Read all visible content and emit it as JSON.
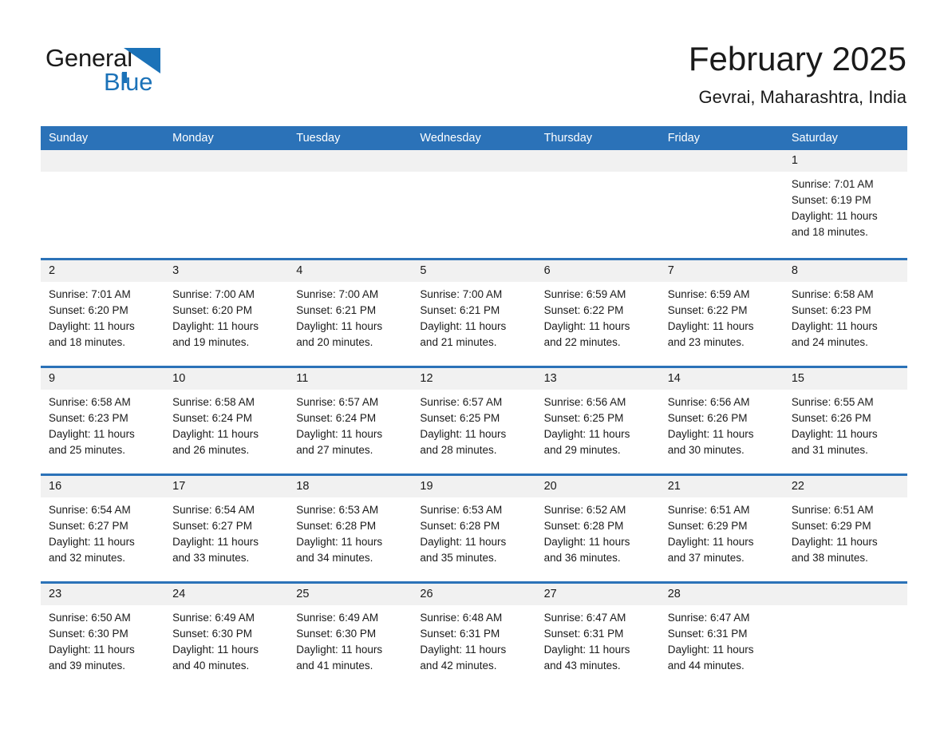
{
  "brand": {
    "name_part1": "General",
    "name_part2": "Blue",
    "accent_color": "#1b72b8"
  },
  "header": {
    "title": "February 2025",
    "subtitle": "Gevrai, Maharashtra, India"
  },
  "theme": {
    "header_bg": "#2b72b8",
    "daynum_band_bg": "#f1f1f1",
    "separator_color": "#2b72b8",
    "text_color": "#1a1a1a",
    "page_bg": "#ffffff"
  },
  "weekday_headers": [
    "Sunday",
    "Monday",
    "Tuesday",
    "Wednesday",
    "Thursday",
    "Friday",
    "Saturday"
  ],
  "labels": {
    "sunrise_prefix": "Sunrise:",
    "sunset_prefix": "Sunset:",
    "daylight_prefix": "Daylight:"
  },
  "weeks": [
    [
      {
        "day": "",
        "empty": true
      },
      {
        "day": "",
        "empty": true
      },
      {
        "day": "",
        "empty": true
      },
      {
        "day": "",
        "empty": true
      },
      {
        "day": "",
        "empty": true
      },
      {
        "day": "",
        "empty": true
      },
      {
        "day": "1",
        "sunrise": "Sunrise: 7:01 AM",
        "sunset": "Sunset: 6:19 PM",
        "daylight_line1": "Daylight: 11 hours",
        "daylight_line2": "and 18 minutes."
      }
    ],
    [
      {
        "day": "2",
        "sunrise": "Sunrise: 7:01 AM",
        "sunset": "Sunset: 6:20 PM",
        "daylight_line1": "Daylight: 11 hours",
        "daylight_line2": "and 18 minutes."
      },
      {
        "day": "3",
        "sunrise": "Sunrise: 7:00 AM",
        "sunset": "Sunset: 6:20 PM",
        "daylight_line1": "Daylight: 11 hours",
        "daylight_line2": "and 19 minutes."
      },
      {
        "day": "4",
        "sunrise": "Sunrise: 7:00 AM",
        "sunset": "Sunset: 6:21 PM",
        "daylight_line1": "Daylight: 11 hours",
        "daylight_line2": "and 20 minutes."
      },
      {
        "day": "5",
        "sunrise": "Sunrise: 7:00 AM",
        "sunset": "Sunset: 6:21 PM",
        "daylight_line1": "Daylight: 11 hours",
        "daylight_line2": "and 21 minutes."
      },
      {
        "day": "6",
        "sunrise": "Sunrise: 6:59 AM",
        "sunset": "Sunset: 6:22 PM",
        "daylight_line1": "Daylight: 11 hours",
        "daylight_line2": "and 22 minutes."
      },
      {
        "day": "7",
        "sunrise": "Sunrise: 6:59 AM",
        "sunset": "Sunset: 6:22 PM",
        "daylight_line1": "Daylight: 11 hours",
        "daylight_line2": "and 23 minutes."
      },
      {
        "day": "8",
        "sunrise": "Sunrise: 6:58 AM",
        "sunset": "Sunset: 6:23 PM",
        "daylight_line1": "Daylight: 11 hours",
        "daylight_line2": "and 24 minutes."
      }
    ],
    [
      {
        "day": "9",
        "sunrise": "Sunrise: 6:58 AM",
        "sunset": "Sunset: 6:23 PM",
        "daylight_line1": "Daylight: 11 hours",
        "daylight_line2": "and 25 minutes."
      },
      {
        "day": "10",
        "sunrise": "Sunrise: 6:58 AM",
        "sunset": "Sunset: 6:24 PM",
        "daylight_line1": "Daylight: 11 hours",
        "daylight_line2": "and 26 minutes."
      },
      {
        "day": "11",
        "sunrise": "Sunrise: 6:57 AM",
        "sunset": "Sunset: 6:24 PM",
        "daylight_line1": "Daylight: 11 hours",
        "daylight_line2": "and 27 minutes."
      },
      {
        "day": "12",
        "sunrise": "Sunrise: 6:57 AM",
        "sunset": "Sunset: 6:25 PM",
        "daylight_line1": "Daylight: 11 hours",
        "daylight_line2": "and 28 minutes."
      },
      {
        "day": "13",
        "sunrise": "Sunrise: 6:56 AM",
        "sunset": "Sunset: 6:25 PM",
        "daylight_line1": "Daylight: 11 hours",
        "daylight_line2": "and 29 minutes."
      },
      {
        "day": "14",
        "sunrise": "Sunrise: 6:56 AM",
        "sunset": "Sunset: 6:26 PM",
        "daylight_line1": "Daylight: 11 hours",
        "daylight_line2": "and 30 minutes."
      },
      {
        "day": "15",
        "sunrise": "Sunrise: 6:55 AM",
        "sunset": "Sunset: 6:26 PM",
        "daylight_line1": "Daylight: 11 hours",
        "daylight_line2": "and 31 minutes."
      }
    ],
    [
      {
        "day": "16",
        "sunrise": "Sunrise: 6:54 AM",
        "sunset": "Sunset: 6:27 PM",
        "daylight_line1": "Daylight: 11 hours",
        "daylight_line2": "and 32 minutes."
      },
      {
        "day": "17",
        "sunrise": "Sunrise: 6:54 AM",
        "sunset": "Sunset: 6:27 PM",
        "daylight_line1": "Daylight: 11 hours",
        "daylight_line2": "and 33 minutes."
      },
      {
        "day": "18",
        "sunrise": "Sunrise: 6:53 AM",
        "sunset": "Sunset: 6:28 PM",
        "daylight_line1": "Daylight: 11 hours",
        "daylight_line2": "and 34 minutes."
      },
      {
        "day": "19",
        "sunrise": "Sunrise: 6:53 AM",
        "sunset": "Sunset: 6:28 PM",
        "daylight_line1": "Daylight: 11 hours",
        "daylight_line2": "and 35 minutes."
      },
      {
        "day": "20",
        "sunrise": "Sunrise: 6:52 AM",
        "sunset": "Sunset: 6:28 PM",
        "daylight_line1": "Daylight: 11 hours",
        "daylight_line2": "and 36 minutes."
      },
      {
        "day": "21",
        "sunrise": "Sunrise: 6:51 AM",
        "sunset": "Sunset: 6:29 PM",
        "daylight_line1": "Daylight: 11 hours",
        "daylight_line2": "and 37 minutes."
      },
      {
        "day": "22",
        "sunrise": "Sunrise: 6:51 AM",
        "sunset": "Sunset: 6:29 PM",
        "daylight_line1": "Daylight: 11 hours",
        "daylight_line2": "and 38 minutes."
      }
    ],
    [
      {
        "day": "23",
        "sunrise": "Sunrise: 6:50 AM",
        "sunset": "Sunset: 6:30 PM",
        "daylight_line1": "Daylight: 11 hours",
        "daylight_line2": "and 39 minutes."
      },
      {
        "day": "24",
        "sunrise": "Sunrise: 6:49 AM",
        "sunset": "Sunset: 6:30 PM",
        "daylight_line1": "Daylight: 11 hours",
        "daylight_line2": "and 40 minutes."
      },
      {
        "day": "25",
        "sunrise": "Sunrise: 6:49 AM",
        "sunset": "Sunset: 6:30 PM",
        "daylight_line1": "Daylight: 11 hours",
        "daylight_line2": "and 41 minutes."
      },
      {
        "day": "26",
        "sunrise": "Sunrise: 6:48 AM",
        "sunset": "Sunset: 6:31 PM",
        "daylight_line1": "Daylight: 11 hours",
        "daylight_line2": "and 42 minutes."
      },
      {
        "day": "27",
        "sunrise": "Sunrise: 6:47 AM",
        "sunset": "Sunset: 6:31 PM",
        "daylight_line1": "Daylight: 11 hours",
        "daylight_line2": "and 43 minutes."
      },
      {
        "day": "28",
        "sunrise": "Sunrise: 6:47 AM",
        "sunset": "Sunset: 6:31 PM",
        "daylight_line1": "Daylight: 11 hours",
        "daylight_line2": "and 44 minutes."
      },
      {
        "day": "",
        "empty": true
      }
    ]
  ]
}
